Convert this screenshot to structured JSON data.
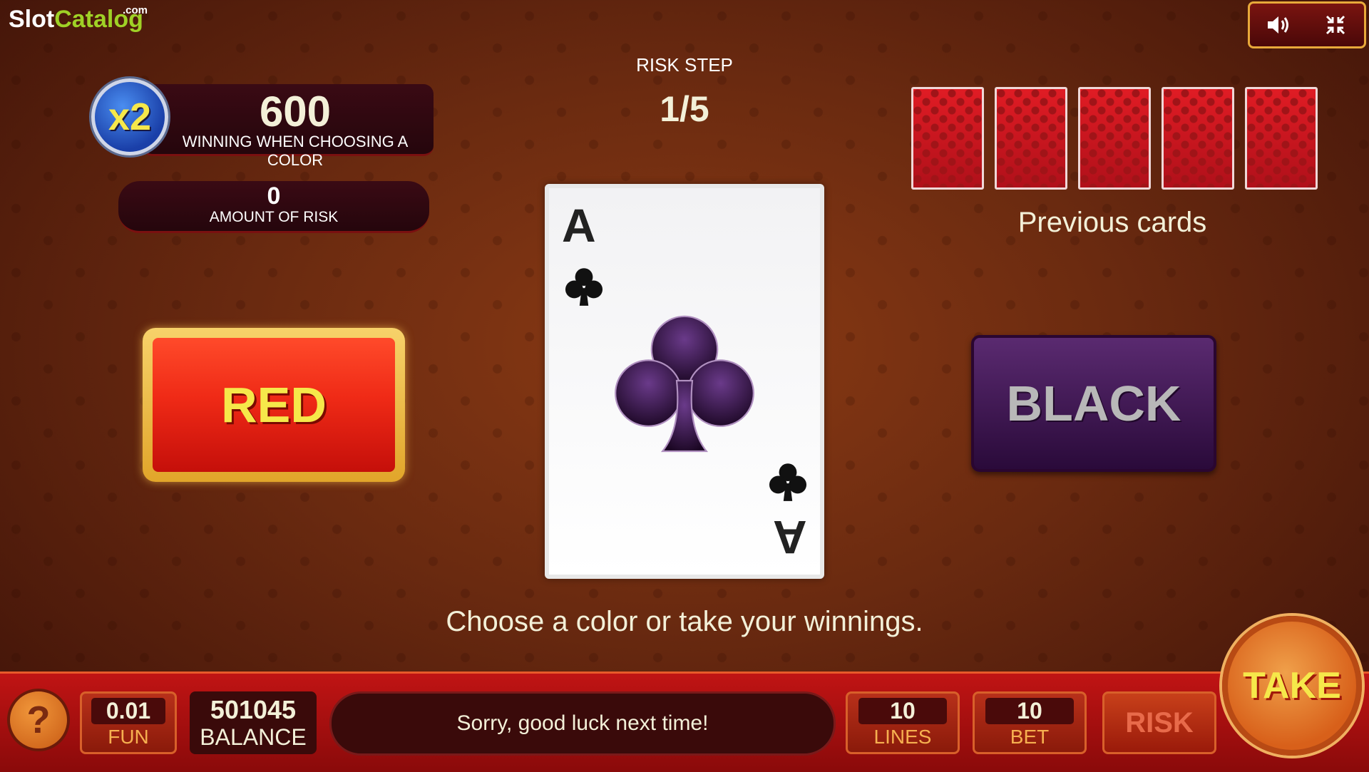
{
  "logo": {
    "slot": "Slot",
    "catalog": "Catalog",
    "com": ".com"
  },
  "controls": {
    "sound_icon": "speaker-icon",
    "fullscreen_icon": "collapse-icon"
  },
  "multiplier": {
    "badge": "x2",
    "value": "600",
    "label": "WINNING WHEN CHOOSING A COLOR"
  },
  "risk_amount": {
    "value": "0",
    "label": "AMOUNT OF RISK"
  },
  "risk_step": {
    "label": "RISK STEP",
    "value": "1/5"
  },
  "previous_cards": {
    "title": "Previous cards",
    "count": 5
  },
  "buttons": {
    "red": "RED",
    "black": "BLACK",
    "take": "TAKE",
    "risk": "RISK",
    "help": "?"
  },
  "card": {
    "rank": "A",
    "suit": "clubs"
  },
  "message": "Choose a color or take your winnings.",
  "bottom": {
    "coin_value": "0.01",
    "coin_label": "FUN",
    "balance_value": "501045",
    "balance_label": "BALANCE",
    "status": "Sorry, good luck next time!",
    "lines_value": "10",
    "lines_label": "LINES",
    "bet_value": "10",
    "bet_label": "BET"
  },
  "colors": {
    "accent_gold": "#e8a93a",
    "red_button": "#ef2a16",
    "black_button": "#3a1450"
  }
}
